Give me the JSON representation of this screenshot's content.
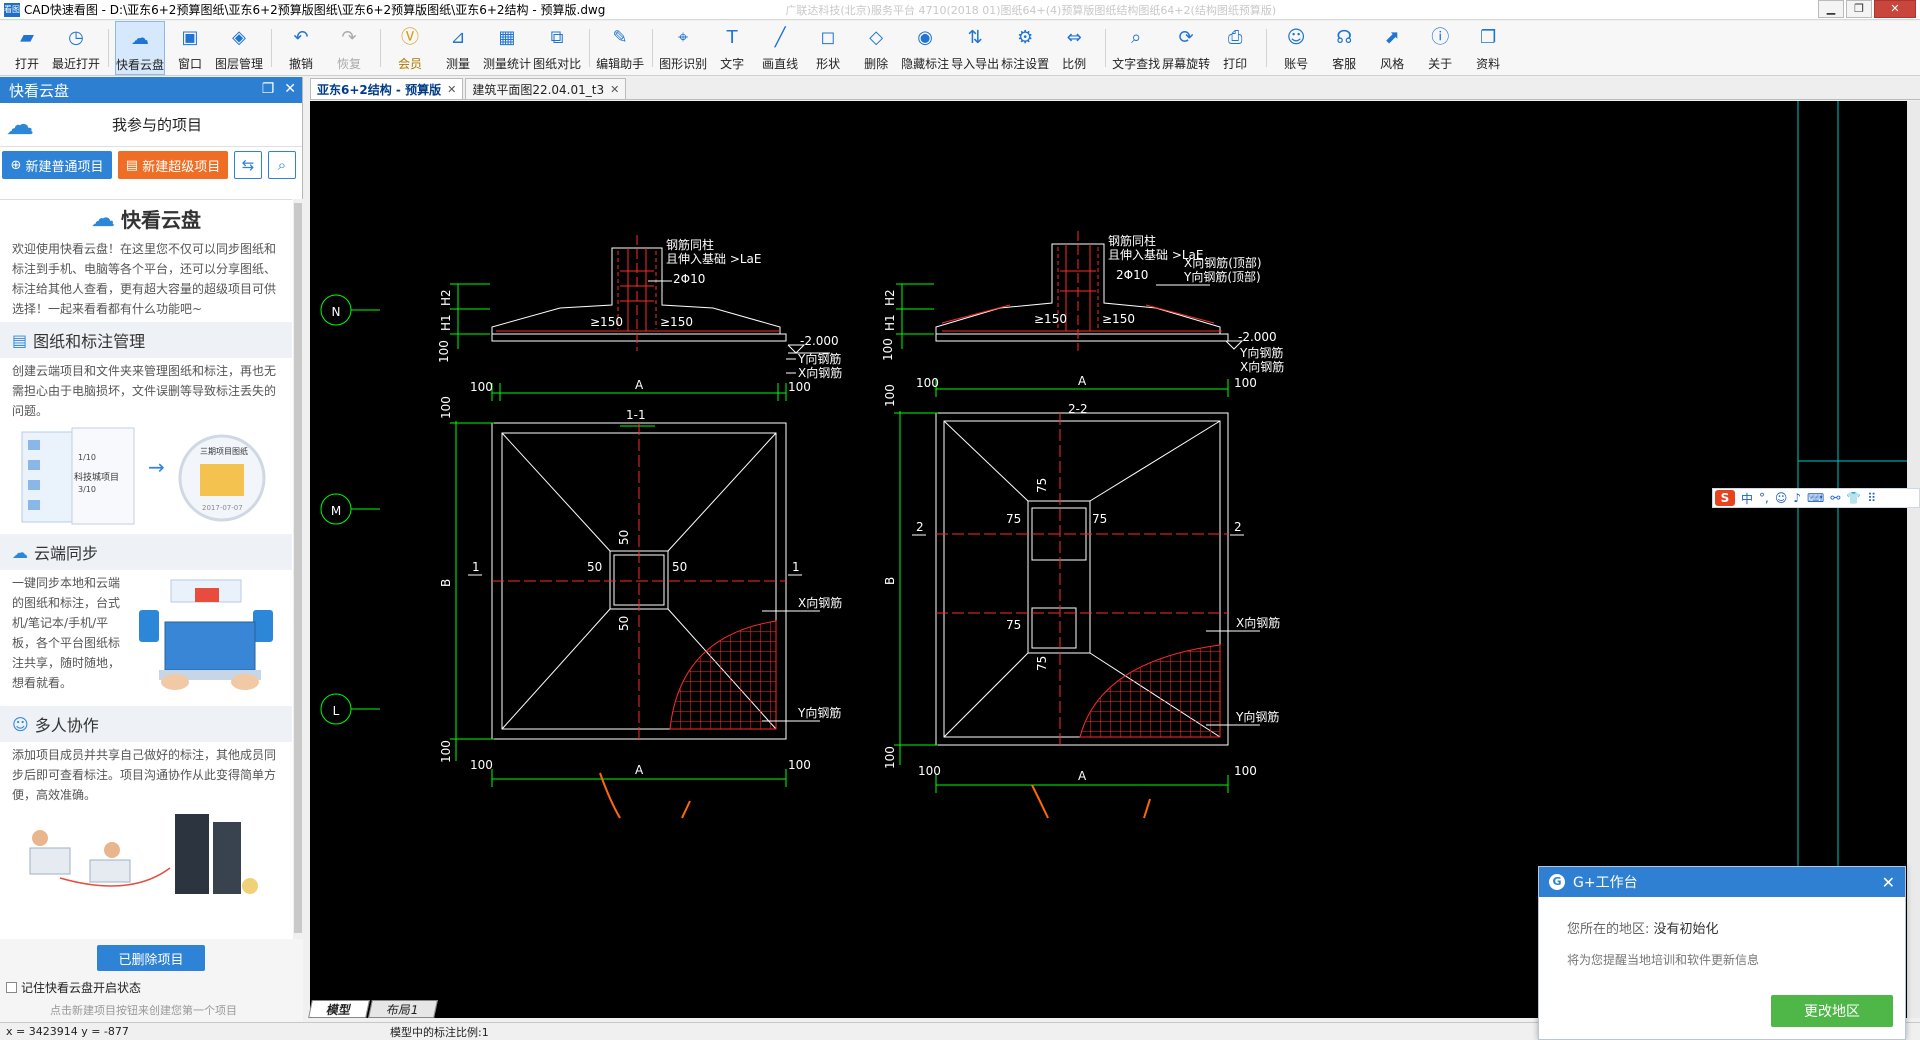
{
  "titlebar": {
    "title": "CAD快速看图 - D:\\亚东6+2预算图纸\\亚东6+2预算版图纸\\亚东6+2预算版图纸\\亚东6+2结构 - 预算版.dwg",
    "faded": "广联达科技(北京)服务平台 4710(2018    01)图纸64+(4)预算版图纸结构图纸64+2(结构图纸预算版)"
  },
  "toolbar": [
    {
      "label": "打开",
      "icon": "folder-open-icon",
      "glyph": "▰"
    },
    {
      "label": "最近打开",
      "icon": "recent-icon",
      "glyph": "◷"
    },
    {
      "label": "快看云盘",
      "icon": "cloud-icon",
      "glyph": "☁"
    },
    {
      "label": "窗口",
      "icon": "window-icon",
      "glyph": "▣"
    },
    {
      "label": "图层管理",
      "icon": "layers-icon",
      "glyph": "◈"
    },
    {
      "label": "撤销",
      "icon": "undo-icon",
      "glyph": "↶"
    },
    {
      "label": "恢复",
      "icon": "redo-icon",
      "glyph": "↷"
    },
    {
      "label": "会员",
      "icon": "vip-icon",
      "glyph": "Ⓥ"
    },
    {
      "label": "测量",
      "icon": "measure-icon",
      "glyph": "⊿"
    },
    {
      "label": "测量统计",
      "icon": "measure-stats-icon",
      "glyph": "▦"
    },
    {
      "label": "图纸对比",
      "icon": "compare-icon",
      "glyph": "⧉"
    },
    {
      "label": "编辑助手",
      "icon": "edit-helper-icon",
      "glyph": "✎"
    },
    {
      "label": "图形识别",
      "icon": "shape-recognition-icon",
      "glyph": "⌖"
    },
    {
      "label": "文字",
      "icon": "text-icon",
      "glyph": "T"
    },
    {
      "label": "画直线",
      "icon": "line-icon",
      "glyph": "╱"
    },
    {
      "label": "形状",
      "icon": "shape-icon",
      "glyph": "◻"
    },
    {
      "label": "删除",
      "icon": "eraser-icon",
      "glyph": "◇"
    },
    {
      "label": "隐藏标注",
      "icon": "hide-annotation-icon",
      "glyph": "◉"
    },
    {
      "label": "导入导出",
      "icon": "import-export-icon",
      "glyph": "⇅"
    },
    {
      "label": "标注设置",
      "icon": "annotation-settings-icon",
      "glyph": "⚙"
    },
    {
      "label": "比例",
      "icon": "scale-icon",
      "glyph": "⇔"
    },
    {
      "label": "文字查找",
      "icon": "text-search-icon",
      "glyph": "⌕"
    },
    {
      "label": "屏幕旋转",
      "icon": "rotate-screen-icon",
      "glyph": "⟳"
    },
    {
      "label": "打印",
      "icon": "print-icon",
      "glyph": "⎙"
    },
    {
      "label": "账号",
      "icon": "account-icon",
      "glyph": "☺"
    },
    {
      "label": "客服",
      "icon": "headset-icon",
      "glyph": "☊"
    },
    {
      "label": "风格",
      "icon": "style-icon",
      "glyph": "⬈"
    },
    {
      "label": "关于",
      "icon": "info-icon",
      "glyph": "ⓘ"
    },
    {
      "label": "资料",
      "icon": "docs-icon",
      "glyph": "❐"
    }
  ],
  "sidebar": {
    "header": "快看云盘",
    "project_title": "我参与的项目",
    "new_normal": "新建普通项目",
    "new_super": "新建超级项目",
    "intro_title": "快看云盘",
    "intro_text": "欢迎使用快看云盘！在这里您不仅可以同步图纸和标注到手机、电脑等各个平台，还可以分享图纸、标注给其他人查看，更有超大容量的超级项目可供选择！一起来看看都有什么功能吧~",
    "sec1_title": "图纸和标注管理",
    "sec1_text": "创建云端项目和文件夹来管理图纸和标注，再也无需担心由于电脑损坏，文件误删等导致标注丢失的问题。",
    "illus1_a": "1/10",
    "illus1_b": "科技城项目",
    "illus1_c": "3/10",
    "illus1_d": "三期项目图纸",
    "illus1_e": "2017-07-07",
    "sec2_title": "云端同步",
    "sec2_text": "一键同步本地和云端的图纸和标注，台式机/笔记本/手机/平板，各个平台图纸标注共享，随时随地，想看就看。",
    "sec3_title": "多人协作",
    "sec3_text": "添加项目成员并共享自己做好的标注，其他成员同步后即可查看标注。项目沟通协作从此变得简单方便，高效准确。",
    "deleted_button": "已删除项目",
    "remember": "记住快看云盘开启状态",
    "hint": "点击新建项目按钮来创建您第一个项目"
  },
  "tabs": [
    {
      "label": "亚东6+2结构 - 预算版"
    },
    {
      "label": "建筑平面图22.04.01_t3"
    }
  ],
  "drawing": {
    "axis_n": "N",
    "axis_m": "M",
    "axis_l": "L",
    "rebar_note1": "钢筋同柱",
    "rebar_note2": "且伸入基础 >LaE",
    "stirrup": "2Φ10",
    "h1": "H1",
    "h2": "H2",
    "elev": "-2.000",
    "ge150_l": "≥150",
    "ge150_r": "≥150",
    "y_rebar": "Y向钢筋",
    "x_rebar": "X向钢筋",
    "x_rebar_top": "X向钢筋(顶部)",
    "y_rebar_top": "Y向钢筋(顶部)",
    "dim100": "100",
    "dimA": "A",
    "dimB": "B",
    "dim50": "50",
    "dim75": "75",
    "sec11": "1-1",
    "sec22": "2-2",
    "cut1": "1",
    "cut2": "2"
  },
  "model_tabs": [
    "模型",
    "布局1"
  ],
  "status": {
    "coords": "x = 3423914  y = -877",
    "scale": "模型中的标注比例:1"
  },
  "ime": {
    "badge": "S",
    "items": [
      "中",
      "°,",
      "☺",
      "♪",
      "⌨",
      "⚯",
      "👕",
      "⠿"
    ]
  },
  "popup": {
    "logo": "G",
    "title": "G+工作台",
    "region_label": "您所在的地区:",
    "region_value": "没有初始化",
    "info": "将为您提醒当地培训和软件更新信息",
    "button": "更改地区"
  },
  "colors": {
    "accent": "#2c7fd1",
    "orange": "#ee6e25",
    "green": "#4fb648",
    "cad_bg": "#000000"
  }
}
